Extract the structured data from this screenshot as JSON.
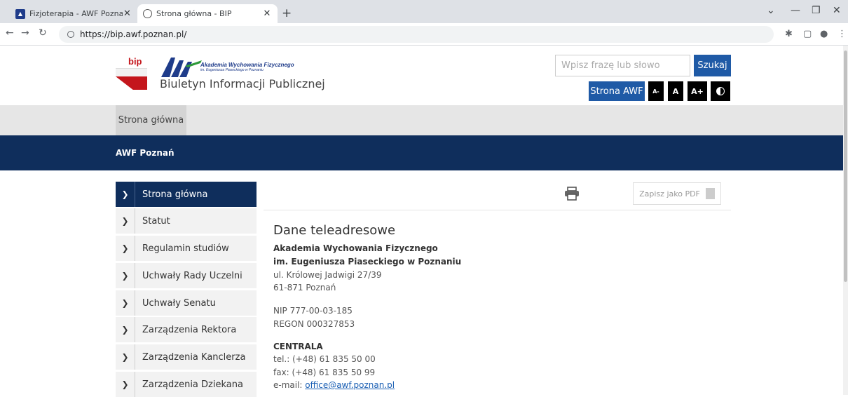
{
  "browser": {
    "tabs": [
      {
        "title": "Fizjoterapia - AWF Poznań"
      },
      {
        "title": "Strona główna - BIP"
      }
    ],
    "url": "https://bip.awf.poznan.pl/"
  },
  "header": {
    "bip_logo_text": "bip",
    "awf_name_line1": "Akademia Wychowania Fizycznego",
    "awf_name_line2": "im. Eugeniusza Piaseckiego w Poznaniu",
    "site_title": "Biuletyn Informacji Publicznej",
    "search_placeholder": "Wpisz frazę lub słowo",
    "search_button": "Szukaj",
    "awf_button": "Strona AWF",
    "font_small": "A-",
    "font_normal": "A",
    "font_large": "A+"
  },
  "navbar": {
    "home_tab": "Strona główna"
  },
  "section": {
    "title": "AWF Poznań"
  },
  "sidebar": {
    "items": [
      {
        "label": "Strona główna"
      },
      {
        "label": "Statut"
      },
      {
        "label": "Regulamin studiów"
      },
      {
        "label": "Uchwały Rady Uczelni"
      },
      {
        "label": "Uchwały Senatu"
      },
      {
        "label": "Zarządzenia Rektora"
      },
      {
        "label": "Zarządzenia Kanclerza"
      },
      {
        "label": "Zarządzenia Dziekana"
      }
    ]
  },
  "content": {
    "pdf_button": "Zapisz jako PDF",
    "title": "Dane teleadresowe",
    "org_line1": "Akademia Wychowania Fizycznego",
    "org_line2": "im. Eugeniusza Piaseckiego w Poznaniu",
    "address1": "ul. Królowej Jadwigi 27/39",
    "address2": "61-871 Poznań",
    "nip": "NIP 777-00-03-185",
    "regon": "REGON 000327853",
    "centrala": "CENTRALA",
    "tel": "tel.: (+48) 61 835 50 00",
    "fax": "fax: (+48) 61 835 50 99",
    "email_label": "e-mail: ",
    "email": "office@awf.poznan.pl"
  },
  "colors": {
    "navy": "#0f2e5c",
    "button_blue": "#1f5aa6",
    "bip_red": "#c4161c"
  }
}
